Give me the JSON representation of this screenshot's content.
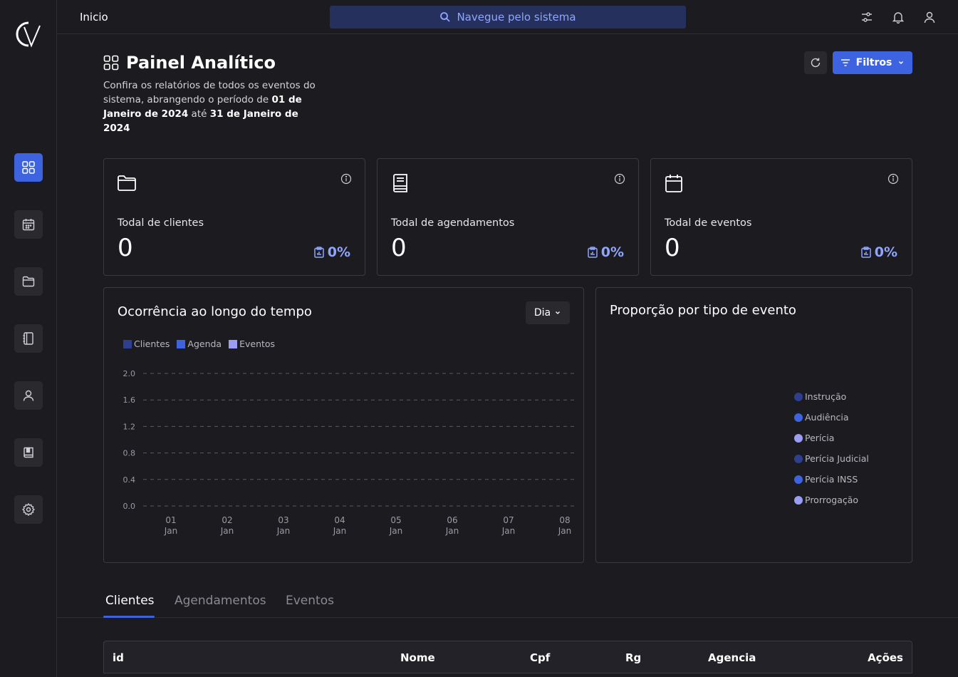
{
  "app": {
    "logo_text": "CV"
  },
  "topbar": {
    "breadcrumb": "Inicio",
    "search_placeholder": "Navegue pelo sistema"
  },
  "header": {
    "title": "Painel Analítico",
    "subtitle_pre": "Confira os relatórios de todos os eventos do sistema, abrangendo o período de ",
    "date_start": "01 de Janeiro de 2024",
    "date_mid": " até ",
    "date_end": "31 de Janeiro de 2024",
    "filter_label": "Filtros"
  },
  "cards": [
    {
      "label": "Todal de clientes",
      "value": "0",
      "percent": "0%",
      "icon": "folder-icon"
    },
    {
      "label": "Todal de agendamentos",
      "value": "0",
      "percent": "0%",
      "icon": "book-icon"
    },
    {
      "label": "Todal de eventos",
      "value": "0",
      "percent": "0%",
      "icon": "calendar-icon"
    }
  ],
  "time_chart": {
    "title": "Ocorrência ao longo do tempo",
    "period_select": "Dia"
  },
  "pie_chart": {
    "title": "Proporção por tipo de evento",
    "legend": [
      {
        "label": "Instrução",
        "color": "#2f3f8f"
      },
      {
        "label": "Audiência",
        "color": "#3d63e0"
      },
      {
        "label": "Perícia",
        "color": "#9b9cf5"
      },
      {
        "label": "Perícia Judicial",
        "color": "#2f3f8f"
      },
      {
        "label": "Perícia INSS",
        "color": "#3d63e0"
      },
      {
        "label": "Prorrogação",
        "color": "#9b9cf5"
      }
    ]
  },
  "chart_data": {
    "type": "line",
    "title": "Ocorrência ao longo do tempo",
    "x": [
      "01 Jan",
      "02 Jan",
      "03 Jan",
      "04 Jan",
      "05 Jan",
      "06 Jan",
      "07 Jan",
      "08 Jan"
    ],
    "x_ticks": [
      [
        "01",
        "Jan"
      ],
      [
        "02",
        "Jan"
      ],
      [
        "03",
        "Jan"
      ],
      [
        "04",
        "Jan"
      ],
      [
        "05",
        "Jan"
      ],
      [
        "06",
        "Jan"
      ],
      [
        "07",
        "Jan"
      ],
      [
        "08",
        "Jan"
      ]
    ],
    "y_ticks": [
      "2.0",
      "1.6",
      "1.2",
      "0.8",
      "0.4",
      "0.0"
    ],
    "ylim": [
      0,
      2
    ],
    "grid": true,
    "legend_position": "top-left",
    "series": [
      {
        "name": "Clientes",
        "color": "#2f3f8f",
        "values": [
          0,
          0,
          0,
          0,
          0,
          0,
          0,
          0
        ]
      },
      {
        "name": "Agenda",
        "color": "#3d63e0",
        "values": [
          0,
          0,
          0,
          0,
          0,
          0,
          0,
          0
        ]
      },
      {
        "name": "Eventos",
        "color": "#9b9cf5",
        "values": [
          0,
          0,
          0,
          0,
          0,
          0,
          0,
          0
        ]
      }
    ]
  },
  "tabs": [
    {
      "label": "Clientes",
      "active": true
    },
    {
      "label": "Agendamentos",
      "active": false
    },
    {
      "label": "Eventos",
      "active": false
    }
  ],
  "table": {
    "columns": [
      "id",
      "Nome",
      "Cpf",
      "Rg",
      "Agencia",
      "Ações"
    ]
  },
  "colors": {
    "accent": "#3d63e0",
    "background": "#1c1b1f",
    "accent_text": "#8fa5ff"
  }
}
